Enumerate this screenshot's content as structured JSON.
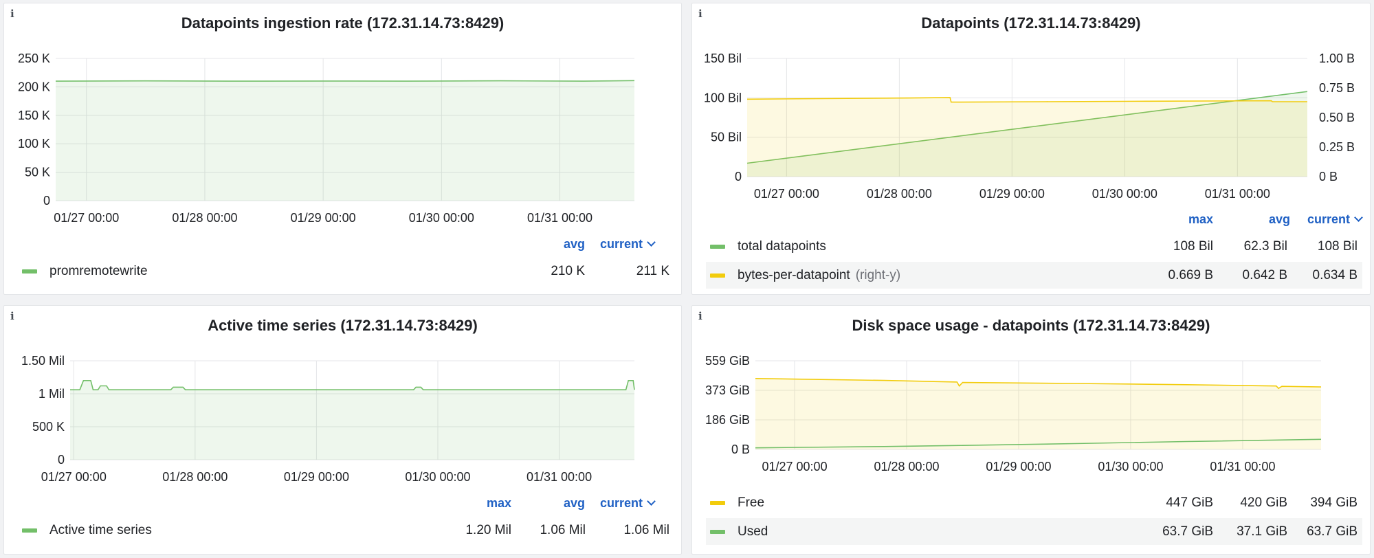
{
  "panels": {
    "ingestion": {
      "title": "Datapoints ingestion rate (172.31.14.73:8429)",
      "legend_headers": {
        "avg": "avg",
        "current": "current"
      },
      "legend_rows": [
        {
          "name": "promremotewrite",
          "avg": "210 K",
          "current": "211 K",
          "color": "#73bf69"
        }
      ]
    },
    "datapoints": {
      "title": "Datapoints (172.31.14.73:8429)",
      "legend_headers": {
        "max": "max",
        "avg": "avg",
        "current": "current"
      },
      "legend_rows": [
        {
          "name": "total datapoints",
          "sub": "",
          "max": "108 Bil",
          "avg": "62.3 Bil",
          "current": "108 Bil",
          "color": "#73bf69"
        },
        {
          "name": "bytes-per-datapoint",
          "sub": "(right-y)",
          "max": "0.669 B",
          "avg": "0.642 B",
          "current": "0.634 B",
          "color": "#f2cc0c"
        }
      ]
    },
    "active": {
      "title": "Active time series (172.31.14.73:8429)",
      "legend_headers": {
        "max": "max",
        "avg": "avg",
        "current": "current"
      },
      "legend_rows": [
        {
          "name": "Active time series",
          "max": "1.20 Mil",
          "avg": "1.06 Mil",
          "current": "1.06 Mil",
          "color": "#73bf69"
        }
      ]
    },
    "disk": {
      "title": "Disk space usage - datapoints (172.31.14.73:8429)",
      "legend_headers": {
        "max": "max",
        "avg": "avg",
        "current": "current"
      },
      "legend_rows": [
        {
          "name": "Free",
          "max": "447 GiB",
          "avg": "420 GiB",
          "current": "394 GiB",
          "color": "#f2cc0c"
        },
        {
          "name": "Used",
          "max": "63.7 GiB",
          "avg": "37.1 GiB",
          "current": "63.7 GiB",
          "color": "#73bf69"
        }
      ]
    }
  },
  "chart_data": [
    {
      "id": "ingestion",
      "type": "area",
      "title": "Datapoints ingestion rate (172.31.14.73:8429)",
      "x_ticks": [
        "01/27 00:00",
        "01/28 00:00",
        "01/29 00:00",
        "01/30 00:00",
        "01/31 00:00"
      ],
      "x_range": [
        -0.26,
        4.63
      ],
      "y_ticks": [
        "0",
        "50 K",
        "100 K",
        "150 K",
        "200 K",
        "250 K"
      ],
      "ylim": [
        0,
        250000
      ],
      "series": [
        {
          "name": "promremotewrite",
          "color": "#73bf69",
          "axis": "left",
          "fill": true,
          "points": [
            [
              -0.26,
              210000
            ],
            [
              0.5,
              210500
            ],
            [
              1.2,
              210000
            ],
            [
              2.0,
              210300
            ],
            [
              2.7,
              210000
            ],
            [
              3.5,
              210600
            ],
            [
              4.2,
              210000
            ],
            [
              4.63,
              211000
            ]
          ]
        }
      ]
    },
    {
      "id": "datapoints",
      "type": "line",
      "title": "Datapoints (172.31.14.73:8429)",
      "x_ticks": [
        "01/27 00:00",
        "01/28 00:00",
        "01/29 00:00",
        "01/30 00:00",
        "01/31 00:00"
      ],
      "x_range": [
        -0.35,
        4.62
      ],
      "y_ticks": [
        "0",
        "50 Bil",
        "100 Bil",
        "150 Bil"
      ],
      "ylim": [
        0,
        150
      ],
      "y2_ticks": [
        "0 B",
        "0.25 B",
        "0.50 B",
        "0.75 B",
        "1.00 B"
      ],
      "y2lim": [
        0,
        1.0
      ],
      "series": [
        {
          "name": "total datapoints",
          "color": "#73bf69",
          "axis": "left",
          "fill": true,
          "points": [
            [
              -0.35,
              17
            ],
            [
              4.62,
              108
            ]
          ]
        },
        {
          "name": "bytes-per-datapoint",
          "color": "#f2cc0c",
          "axis": "right",
          "fill": true,
          "points": [
            [
              -0.35,
              0.655
            ],
            [
              0.3,
              0.66
            ],
            [
              1.1,
              0.665
            ],
            [
              1.45,
              0.669
            ],
            [
              1.46,
              0.63
            ],
            [
              2.3,
              0.634
            ],
            [
              3.2,
              0.638
            ],
            [
              4.3,
              0.642
            ],
            [
              4.31,
              0.634
            ],
            [
              4.62,
              0.634
            ]
          ]
        }
      ]
    },
    {
      "id": "active",
      "type": "area",
      "title": "Active time series (172.31.14.73:8429)",
      "x_ticks": [
        "01/27 00:00",
        "01/28 00:00",
        "01/29 00:00",
        "01/30 00:00",
        "01/31 00:00"
      ],
      "x_range": [
        -0.03,
        4.62
      ],
      "y_ticks": [
        "0",
        "500 K",
        "1 Mil",
        "1.50 Mil"
      ],
      "ylim": [
        0,
        1500000
      ],
      "series": [
        {
          "name": "Active time series",
          "color": "#73bf69",
          "axis": "left",
          "fill": true,
          "points": [
            [
              -0.03,
              1060000
            ],
            [
              0.05,
              1060000
            ],
            [
              0.08,
              1200000
            ],
            [
              0.14,
              1200000
            ],
            [
              0.16,
              1060000
            ],
            [
              0.2,
              1060000
            ],
            [
              0.22,
              1120000
            ],
            [
              0.27,
              1120000
            ],
            [
              0.29,
              1060000
            ],
            [
              0.8,
              1060000
            ],
            [
              0.82,
              1100000
            ],
            [
              0.9,
              1100000
            ],
            [
              0.92,
              1060000
            ],
            [
              2.8,
              1060000
            ],
            [
              2.82,
              1100000
            ],
            [
              2.86,
              1100000
            ],
            [
              2.88,
              1060000
            ],
            [
              4.55,
              1060000
            ],
            [
              4.57,
              1200000
            ],
            [
              4.61,
              1200000
            ],
            [
              4.62,
              1060000
            ]
          ]
        }
      ]
    },
    {
      "id": "disk",
      "type": "area",
      "title": "Disk space usage - datapoints (172.31.14.73:8429)",
      "x_ticks": [
        "01/27 00:00",
        "01/28 00:00",
        "01/29 00:00",
        "01/30 00:00",
        "01/31 00:00"
      ],
      "x_range": [
        -0.35,
        4.7
      ],
      "y_ticks": [
        "0 B",
        "186 GiB",
        "373 GiB",
        "559 GiB"
      ],
      "ylim": [
        0,
        559
      ],
      "series": [
        {
          "name": "Free",
          "color": "#f2cc0c",
          "axis": "left",
          "fill": true,
          "points": [
            [
              -0.35,
              447
            ],
            [
              0.8,
              435
            ],
            [
              1.45,
              425
            ],
            [
              1.47,
              400
            ],
            [
              1.5,
              422
            ],
            [
              2.5,
              416
            ],
            [
              3.5,
              408
            ],
            [
              4.3,
              400
            ],
            [
              4.32,
              385
            ],
            [
              4.35,
              398
            ],
            [
              4.7,
              394
            ]
          ]
        },
        {
          "name": "Used",
          "color": "#73bf69",
          "axis": "left",
          "fill": false,
          "points": [
            [
              -0.35,
              10
            ],
            [
              0.8,
              18
            ],
            [
              1.5,
              25
            ],
            [
              2.5,
              37
            ],
            [
              3.5,
              50
            ],
            [
              4.7,
              63.7
            ]
          ]
        }
      ]
    }
  ]
}
